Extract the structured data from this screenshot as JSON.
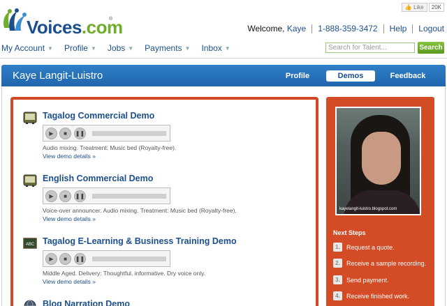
{
  "header": {
    "logo_text_main": "Voices",
    "logo_text_dot": ".com",
    "logo_reg": "®",
    "like_label": "Like",
    "like_count": "20K",
    "welcome_prefix": "Welcome,",
    "user_name": "Kaye",
    "phone": "1-888-359-3472",
    "help_label": "Help",
    "logout_label": "Logout"
  },
  "mainnav": {
    "items": [
      {
        "label": "My Account"
      },
      {
        "label": "Profile"
      },
      {
        "label": "Jobs"
      },
      {
        "label": "Payments"
      },
      {
        "label": "Inbox"
      }
    ],
    "caret": "▼"
  },
  "search": {
    "placeholder": "Search for Talent...",
    "button_label": "Search"
  },
  "profile_bar": {
    "name": "Kaye Langit-Luistro",
    "tabs": [
      {
        "label": "Profile"
      },
      {
        "label": "Demos",
        "active": true
      },
      {
        "label": "Feedback"
      }
    ]
  },
  "demos": [
    {
      "title": "Tagalog Commercial Demo",
      "icon": "tv-icon",
      "description": "Audio mixing. Treatment: Music bed (Royalty-free).",
      "link": "View demo details »"
    },
    {
      "title": "English Commercial Demo",
      "icon": "tv-icon",
      "description": "Voice-over announcer. Audio mixing. Treatment: Music bed (Royalty-free).",
      "link": "View demo details »"
    },
    {
      "title": "Tagalog E-Learning & Business Training Demo",
      "icon": "chalkboard-icon",
      "icon_text": "ABC",
      "description": "Middle Aged. Delivery: Thoughtful, informative. Dry voice only.",
      "link": "View demo details »"
    },
    {
      "title": "Blog Narration Demo",
      "icon": "globe-icon"
    }
  ],
  "player": {
    "play_glyph": "▶",
    "stop_glyph": "■",
    "pause_glyph": "❚❚"
  },
  "side": {
    "photo_caption": "kayelangit-luistro.blogspot.com",
    "next_steps_title": "Next Steps",
    "steps": [
      {
        "num": "1.",
        "label": "Request a quote."
      },
      {
        "num": "2.",
        "label": "Receive a sample recording."
      },
      {
        "num": "3.",
        "label": "Send payment."
      },
      {
        "num": "4.",
        "label": "Receive finished work."
      }
    ]
  },
  "colors": {
    "brand_blue": "#1c4f8e",
    "accent_orange": "#d44c26",
    "bar_blue": "#2a78c2",
    "search_green": "#6fae2c"
  }
}
